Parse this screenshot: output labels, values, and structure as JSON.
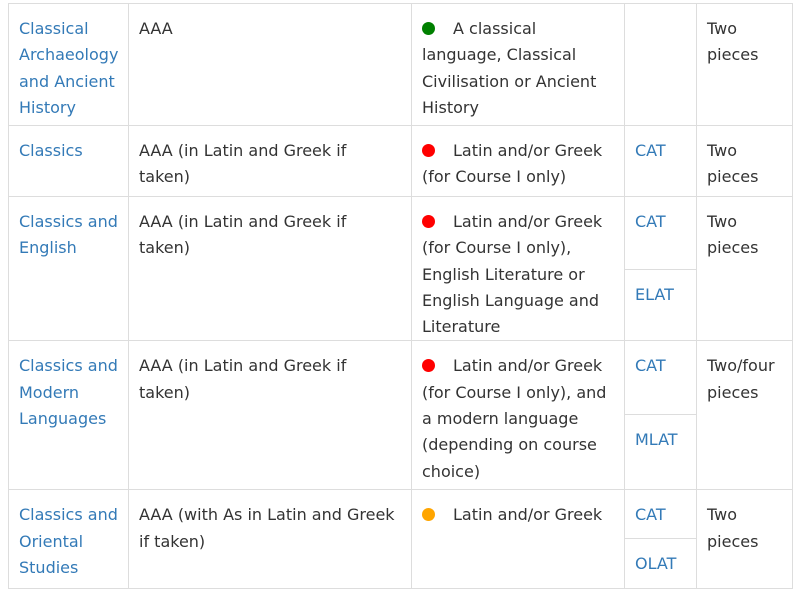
{
  "colors": {
    "link": "#337ab7",
    "text": "#333333",
    "border": "#dddddd",
    "green": "#008000",
    "red": "#ff0000",
    "orange": "#ffa500"
  },
  "rows": [
    {
      "course": "Classical Archaeology and Ancient History",
      "grades": "AAA",
      "dot": "green-dot-icon",
      "subjects": "A classical language, Classical Civilisation or Ancient History",
      "tests": [],
      "work": "Two pieces"
    },
    {
      "course": "Classics",
      "grades": "AAA (in Latin and Greek if taken)",
      "dot": "red-dot-icon",
      "subjects": "Latin and/or Greek (for Course I only)",
      "tests": [
        "CAT"
      ],
      "work": "Two pieces"
    },
    {
      "course": "Classics and English",
      "grades": "AAA (in Latin and Greek if taken)",
      "dot": "red-dot-icon",
      "subjects": "Latin and/or Greek (for Course I only), English Literature or English Language and Literature",
      "tests": [
        "CAT",
        "ELAT"
      ],
      "work": "Two pieces"
    },
    {
      "course": "Classics and Modern Languages",
      "grades": "AAA (in Latin and Greek if taken)",
      "dot": "red-dot-icon",
      "subjects": "Latin and/or Greek (for Course I only), and a modern language (depending on course choice)",
      "tests": [
        "CAT",
        "MLAT"
      ],
      "work": "Two/four pieces"
    },
    {
      "course": "Classics and Oriental Studies",
      "grades": "AAA (with As in Latin and Greek if taken)",
      "dot": "orange-dot-icon",
      "subjects": "Latin and/or Greek",
      "tests": [
        "CAT",
        "OLAT"
      ],
      "work": "Two pieces"
    }
  ]
}
